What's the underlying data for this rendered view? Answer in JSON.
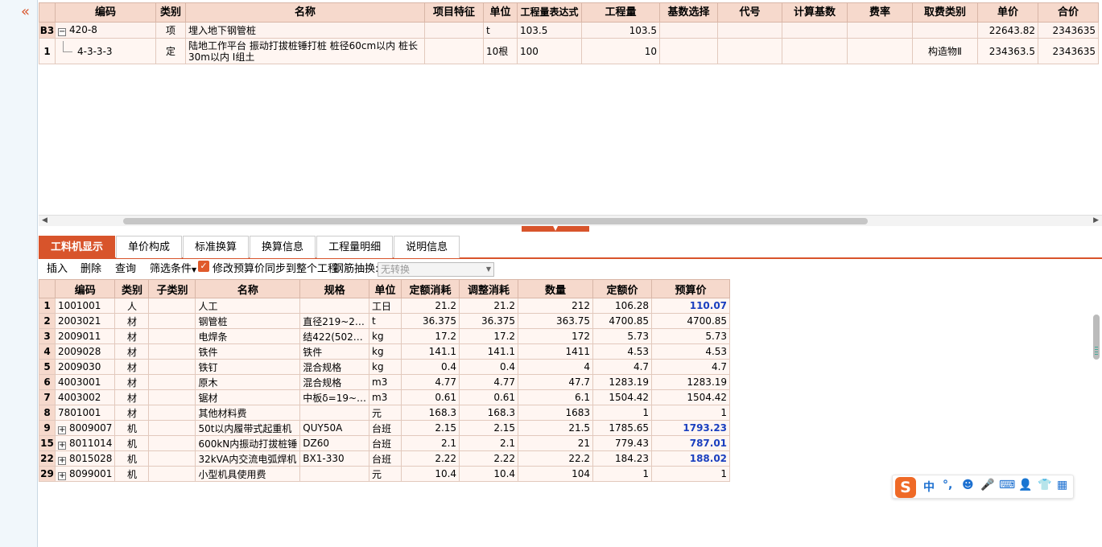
{
  "top_table": {
    "headers": [
      "编码",
      "类别",
      "名称",
      "项目特征",
      "单位",
      "工程量表达式",
      "工程量",
      "基数选择",
      "代号",
      "计算基数",
      "费率",
      "取费类别",
      "单价",
      "合价"
    ],
    "rows": [
      {
        "rowhead": "B3",
        "code": "420-8",
        "type": "项",
        "name": "埋入地下钢管桩",
        "feature": "",
        "unit": "t",
        "expr": "103.5",
        "qty": "103.5",
        "base_sel": "",
        "alias": "",
        "calc_base": "",
        "rate": "",
        "fee_type": "",
        "price": "22643.82",
        "total": "2343635"
      },
      {
        "rowhead": "1",
        "code": "4-3-3-3",
        "type": "定",
        "name": "陆地工作平台 振动打拔桩锤打桩 桩径60cm以内 桩长30m以内 Ⅰ组土",
        "feature": "",
        "unit": "10根",
        "expr": "100",
        "qty": "10",
        "base_sel": "",
        "alias": "",
        "calc_base": "",
        "rate": "",
        "fee_type": "构造物Ⅱ",
        "price": "234363.5",
        "total": "2343635"
      }
    ]
  },
  "tabs": [
    "工料机显示",
    "单价构成",
    "标准换算",
    "换算信息",
    "工程量明细",
    "说明信息"
  ],
  "toolbar": {
    "insert": "插入",
    "delete": "删除",
    "query": "查询",
    "filter": "筛选条件",
    "sync_label": "修改预算价同步到整个工程",
    "rebar_label": "钢筋抽换:",
    "rebar_value": "无转换"
  },
  "bottom_table": {
    "headers": [
      "编码",
      "类别",
      "子类别",
      "名称",
      "规格",
      "单位",
      "定额消耗",
      "调整消耗",
      "数量",
      "定额价",
      "预算价"
    ],
    "rows": [
      {
        "rowhead": "1",
        "expand": false,
        "code": "1001001",
        "type": "人",
        "sub": "",
        "name": "人工",
        "spec": "",
        "unit": "工日",
        "quota": "21.2",
        "adj": "21.2",
        "qty": "212",
        "qprice": "106.28",
        "bprice": "110.07",
        "hl": true
      },
      {
        "rowhead": "2",
        "expand": false,
        "code": "2003021",
        "type": "材",
        "sub": "",
        "name": "钢管桩",
        "spec": "直径219~2…",
        "unit": "t",
        "quota": "36.375",
        "adj": "36.375",
        "qty": "363.75",
        "qprice": "4700.85",
        "bprice": "4700.85",
        "hl": false
      },
      {
        "rowhead": "3",
        "expand": false,
        "code": "2009011",
        "type": "材",
        "sub": "",
        "name": "电焊条",
        "spec": "结422(502…",
        "unit": "kg",
        "quota": "17.2",
        "adj": "17.2",
        "qty": "172",
        "qprice": "5.73",
        "bprice": "5.73",
        "hl": false
      },
      {
        "rowhead": "4",
        "expand": false,
        "code": "2009028",
        "type": "材",
        "sub": "",
        "name": "铁件",
        "spec": "铁件",
        "unit": "kg",
        "quota": "141.1",
        "adj": "141.1",
        "qty": "1411",
        "qprice": "4.53",
        "bprice": "4.53",
        "hl": false
      },
      {
        "rowhead": "5",
        "expand": false,
        "code": "2009030",
        "type": "材",
        "sub": "",
        "name": "铁钉",
        "spec": "混合规格",
        "unit": "kg",
        "quota": "0.4",
        "adj": "0.4",
        "qty": "4",
        "qprice": "4.7",
        "bprice": "4.7",
        "hl": false
      },
      {
        "rowhead": "6",
        "expand": false,
        "code": "4003001",
        "type": "材",
        "sub": "",
        "name": "原木",
        "spec": "混合规格",
        "unit": "m3",
        "quota": "4.77",
        "adj": "4.77",
        "qty": "47.7",
        "qprice": "1283.19",
        "bprice": "1283.19",
        "hl": false
      },
      {
        "rowhead": "7",
        "expand": false,
        "code": "4003002",
        "type": "材",
        "sub": "",
        "name": "锯材",
        "spec": "中板δ=19~…",
        "unit": "m3",
        "quota": "0.61",
        "adj": "0.61",
        "qty": "6.1",
        "qprice": "1504.42",
        "bprice": "1504.42",
        "hl": false
      },
      {
        "rowhead": "8",
        "expand": false,
        "code": "7801001",
        "type": "材",
        "sub": "",
        "name": "其他材料费",
        "spec": "",
        "unit": "元",
        "quota": "168.3",
        "adj": "168.3",
        "qty": "1683",
        "qprice": "1",
        "bprice": "1",
        "hl": false
      },
      {
        "rowhead": "9",
        "expand": true,
        "code": "8009007",
        "type": "机",
        "sub": "",
        "name": "50t以内履带式起重机",
        "spec": "QUY50A",
        "unit": "台班",
        "quota": "2.15",
        "adj": "2.15",
        "qty": "21.5",
        "qprice": "1785.65",
        "bprice": "1793.23",
        "hl": true
      },
      {
        "rowhead": "15",
        "expand": true,
        "code": "8011014",
        "type": "机",
        "sub": "",
        "name": "600kN内振动打拔桩锤",
        "spec": "DZ60",
        "unit": "台班",
        "quota": "2.1",
        "adj": "2.1",
        "qty": "21",
        "qprice": "779.43",
        "bprice": "787.01",
        "hl": true
      },
      {
        "rowhead": "22",
        "expand": true,
        "code": "8015028",
        "type": "机",
        "sub": "",
        "name": "32kVA内交流电弧焊机",
        "spec": "BX1-330",
        "unit": "台班",
        "quota": "2.22",
        "adj": "2.22",
        "qty": "22.2",
        "qprice": "184.23",
        "bprice": "188.02",
        "hl": true
      },
      {
        "rowhead": "29",
        "expand": true,
        "code": "8099001",
        "type": "机",
        "sub": "",
        "name": "小型机具使用费",
        "spec": "",
        "unit": "元",
        "quota": "10.4",
        "adj": "10.4",
        "qty": "104",
        "qprice": "1",
        "bprice": "1",
        "hl": false
      }
    ]
  },
  "ime": {
    "logo": "S",
    "items": [
      "中",
      "°,",
      "☻",
      "🎤",
      "⌨",
      "👤",
      "👕",
      "▦"
    ]
  },
  "colors": {
    "accent": "#d8542b",
    "header_bg": "#f6d9cc",
    "highlight_price": "#1a3fbf"
  }
}
